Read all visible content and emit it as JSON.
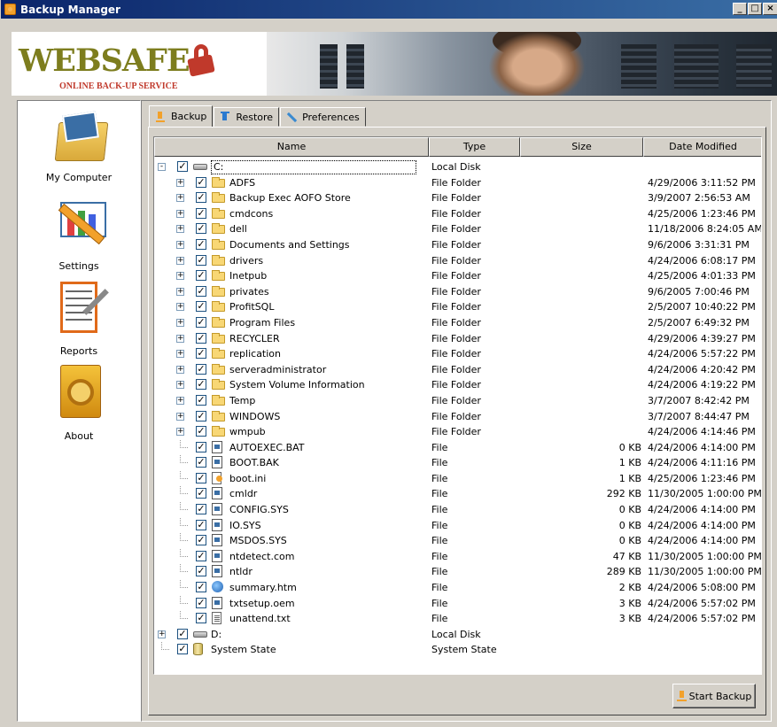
{
  "window": {
    "title": "Backup Manager"
  },
  "banner": {
    "logo_text": "WEBSAFE",
    "logo_sub": "ONLINE BACK-UP SERVICE"
  },
  "sidebar": {
    "items": [
      {
        "label": "My Computer",
        "icon": "folder-icon"
      },
      {
        "label": "Settings",
        "icon": "settings-tools-icon"
      },
      {
        "label": "Reports",
        "icon": "report-icon"
      },
      {
        "label": "About",
        "icon": "safe-icon"
      }
    ]
  },
  "tabs": [
    {
      "label": "Backup",
      "icon": "backup-arrow-icon",
      "active": true
    },
    {
      "label": "Restore",
      "icon": "restore-arrow-icon",
      "active": false
    },
    {
      "label": "Preferences",
      "icon": "wrench-icon",
      "active": false
    }
  ],
  "columns": [
    "Name",
    "Type",
    "Size",
    "Date Modified"
  ],
  "rows": [
    {
      "level": 0,
      "expander": "-",
      "icon": "drive",
      "name": "C:",
      "type": "Local Disk",
      "size": "",
      "date": ""
    },
    {
      "level": 1,
      "expander": "+",
      "icon": "folder",
      "name": "ADFS",
      "type": "File Folder",
      "size": "",
      "date": "4/29/2006 3:11:52 PM"
    },
    {
      "level": 1,
      "expander": "+",
      "icon": "folder",
      "name": "Backup Exec AOFO Store",
      "type": "File Folder",
      "size": "",
      "date": "3/9/2007 2:56:53 AM"
    },
    {
      "level": 1,
      "expander": "+",
      "icon": "folder",
      "name": "cmdcons",
      "type": "File Folder",
      "size": "",
      "date": "4/25/2006 1:23:46 PM"
    },
    {
      "level": 1,
      "expander": "+",
      "icon": "folder",
      "name": "dell",
      "type": "File Folder",
      "size": "",
      "date": "11/18/2006 8:24:05 AM"
    },
    {
      "level": 1,
      "expander": "+",
      "icon": "folder",
      "name": "Documents and Settings",
      "type": "File Folder",
      "size": "",
      "date": "9/6/2006 3:31:31 PM"
    },
    {
      "level": 1,
      "expander": "+",
      "icon": "folder",
      "name": "drivers",
      "type": "File Folder",
      "size": "",
      "date": "4/24/2006 6:08:17 PM"
    },
    {
      "level": 1,
      "expander": "+",
      "icon": "folder",
      "name": "Inetpub",
      "type": "File Folder",
      "size": "",
      "date": "4/25/2006 4:01:33 PM"
    },
    {
      "level": 1,
      "expander": "+",
      "icon": "folder",
      "name": "privates",
      "type": "File Folder",
      "size": "",
      "date": "9/6/2005 7:00:46 PM"
    },
    {
      "level": 1,
      "expander": "+",
      "icon": "folder",
      "name": "ProfitSQL",
      "type": "File Folder",
      "size": "",
      "date": "2/5/2007 10:40:22 PM"
    },
    {
      "level": 1,
      "expander": "+",
      "icon": "folder",
      "name": "Program Files",
      "type": "File Folder",
      "size": "",
      "date": "2/5/2007 6:49:32 PM"
    },
    {
      "level": 1,
      "expander": "+",
      "icon": "folder",
      "name": "RECYCLER",
      "type": "File Folder",
      "size": "",
      "date": "4/29/2006 4:39:27 PM"
    },
    {
      "level": 1,
      "expander": "+",
      "icon": "folder",
      "name": "replication",
      "type": "File Folder",
      "size": "",
      "date": "4/24/2006 5:57:22 PM"
    },
    {
      "level": 1,
      "expander": "+",
      "icon": "folder",
      "name": "serveradministrator",
      "type": "File Folder",
      "size": "",
      "date": "4/24/2006 4:20:42 PM"
    },
    {
      "level": 1,
      "expander": "+",
      "icon": "folder",
      "name": "System Volume Information",
      "type": "File Folder",
      "size": "",
      "date": "4/24/2006 4:19:22 PM"
    },
    {
      "level": 1,
      "expander": "+",
      "icon": "folder",
      "name": "Temp",
      "type": "File Folder",
      "size": "",
      "date": "3/7/2007 8:42:42 PM"
    },
    {
      "level": 1,
      "expander": "+",
      "icon": "folder",
      "name": "WINDOWS",
      "type": "File Folder",
      "size": "",
      "date": "3/7/2007 8:44:47 PM"
    },
    {
      "level": 1,
      "expander": "+",
      "icon": "folder",
      "name": "wmpub",
      "type": "File Folder",
      "size": "",
      "date": "4/24/2006 4:14:46 PM"
    },
    {
      "level": 1,
      "expander": "",
      "icon": "file",
      "name": "AUTOEXEC.BAT",
      "type": "File",
      "size": "0 KB",
      "date": "4/24/2006 4:14:00 PM"
    },
    {
      "level": 1,
      "expander": "",
      "icon": "file",
      "name": "BOOT.BAK",
      "type": "File",
      "size": "1 KB",
      "date": "4/24/2006 4:11:16 PM"
    },
    {
      "level": 1,
      "expander": "",
      "icon": "ini",
      "name": "boot.ini",
      "type": "File",
      "size": "1 KB",
      "date": "4/25/2006 1:23:46 PM"
    },
    {
      "level": 1,
      "expander": "",
      "icon": "file",
      "name": "cmldr",
      "type": "File",
      "size": "292 KB",
      "date": "11/30/2005 1:00:00 PM"
    },
    {
      "level": 1,
      "expander": "",
      "icon": "file",
      "name": "CONFIG.SYS",
      "type": "File",
      "size": "0 KB",
      "date": "4/24/2006 4:14:00 PM"
    },
    {
      "level": 1,
      "expander": "",
      "icon": "file",
      "name": "IO.SYS",
      "type": "File",
      "size": "0 KB",
      "date": "4/24/2006 4:14:00 PM"
    },
    {
      "level": 1,
      "expander": "",
      "icon": "file",
      "name": "MSDOS.SYS",
      "type": "File",
      "size": "0 KB",
      "date": "4/24/2006 4:14:00 PM"
    },
    {
      "level": 1,
      "expander": "",
      "icon": "file",
      "name": "ntdetect.com",
      "type": "File",
      "size": "47 KB",
      "date": "11/30/2005 1:00:00 PM"
    },
    {
      "level": 1,
      "expander": "",
      "icon": "file",
      "name": "ntldr",
      "type": "File",
      "size": "289 KB",
      "date": "11/30/2005 1:00:00 PM"
    },
    {
      "level": 1,
      "expander": "",
      "icon": "globe",
      "name": "summary.htm",
      "type": "File",
      "size": "2 KB",
      "date": "4/24/2006 5:08:00 PM"
    },
    {
      "level": 1,
      "expander": "",
      "icon": "file",
      "name": "txtsetup.oem",
      "type": "File",
      "size": "3 KB",
      "date": "4/24/2006 5:57:02 PM"
    },
    {
      "level": 1,
      "expander": "",
      "icon": "txt",
      "name": "unattend.txt",
      "type": "File",
      "size": "3 KB",
      "date": "4/24/2006 5:57:02 PM"
    },
    {
      "level": 0,
      "expander": "+",
      "icon": "drive",
      "name": "D:",
      "type": "Local Disk",
      "size": "",
      "date": ""
    },
    {
      "level": 0,
      "expander": "",
      "icon": "db",
      "name": "System State",
      "type": "System State",
      "size": "",
      "date": ""
    }
  ],
  "start_button": {
    "label": "Start Backup"
  }
}
